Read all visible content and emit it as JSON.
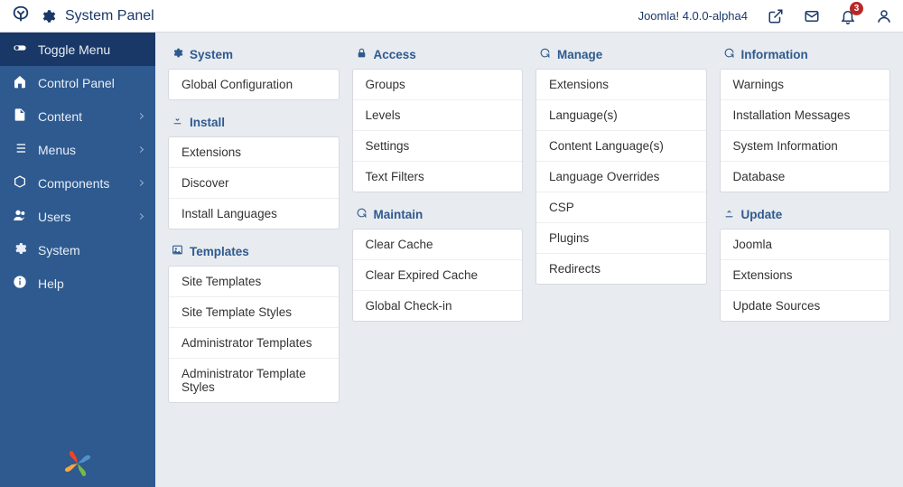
{
  "topbar": {
    "title": "System Panel",
    "version": "Joomla! 4.0.0-alpha4",
    "notification_count": "3"
  },
  "sidebar": {
    "items": [
      {
        "label": "Toggle Menu",
        "icon": "toggle",
        "chev": false,
        "active": true
      },
      {
        "label": "Control Panel",
        "icon": "home",
        "chev": false
      },
      {
        "label": "Content",
        "icon": "file",
        "chev": true
      },
      {
        "label": "Menus",
        "icon": "list",
        "chev": true
      },
      {
        "label": "Components",
        "icon": "cube",
        "chev": true
      },
      {
        "label": "Users",
        "icon": "users",
        "chev": true
      },
      {
        "label": "System",
        "icon": "gear",
        "chev": false
      },
      {
        "label": "Help",
        "icon": "info",
        "chev": false
      }
    ]
  },
  "columns": [
    [
      {
        "title": "System",
        "icon": "gear",
        "items": [
          "Global Configuration"
        ]
      },
      {
        "title": "Install",
        "icon": "download",
        "items": [
          "Extensions",
          "Discover",
          "Install Languages"
        ]
      },
      {
        "title": "Templates",
        "icon": "image",
        "items": [
          "Site Templates",
          "Site Template Styles",
          "Administrator Templates",
          "Administrator Template Styles"
        ]
      }
    ],
    [
      {
        "title": "Access",
        "icon": "lock",
        "items": [
          "Groups",
          "Levels",
          "Settings",
          "Text Filters"
        ]
      },
      {
        "title": "Maintain",
        "icon": "refresh",
        "items": [
          "Clear Cache",
          "Clear Expired Cache",
          "Global Check-in"
        ]
      }
    ],
    [
      {
        "title": "Manage",
        "icon": "refresh",
        "items": [
          "Extensions",
          "Language(s)",
          "Content Language(s)",
          "Language Overrides",
          "CSP",
          "Plugins",
          "Redirects"
        ]
      }
    ],
    [
      {
        "title": "Information",
        "icon": "refresh",
        "items": [
          "Warnings",
          "Installation Messages",
          "System Information",
          "Database"
        ]
      },
      {
        "title": "Update",
        "icon": "upload",
        "items": [
          "Joomla",
          "Extensions",
          "Update Sources"
        ]
      }
    ]
  ]
}
